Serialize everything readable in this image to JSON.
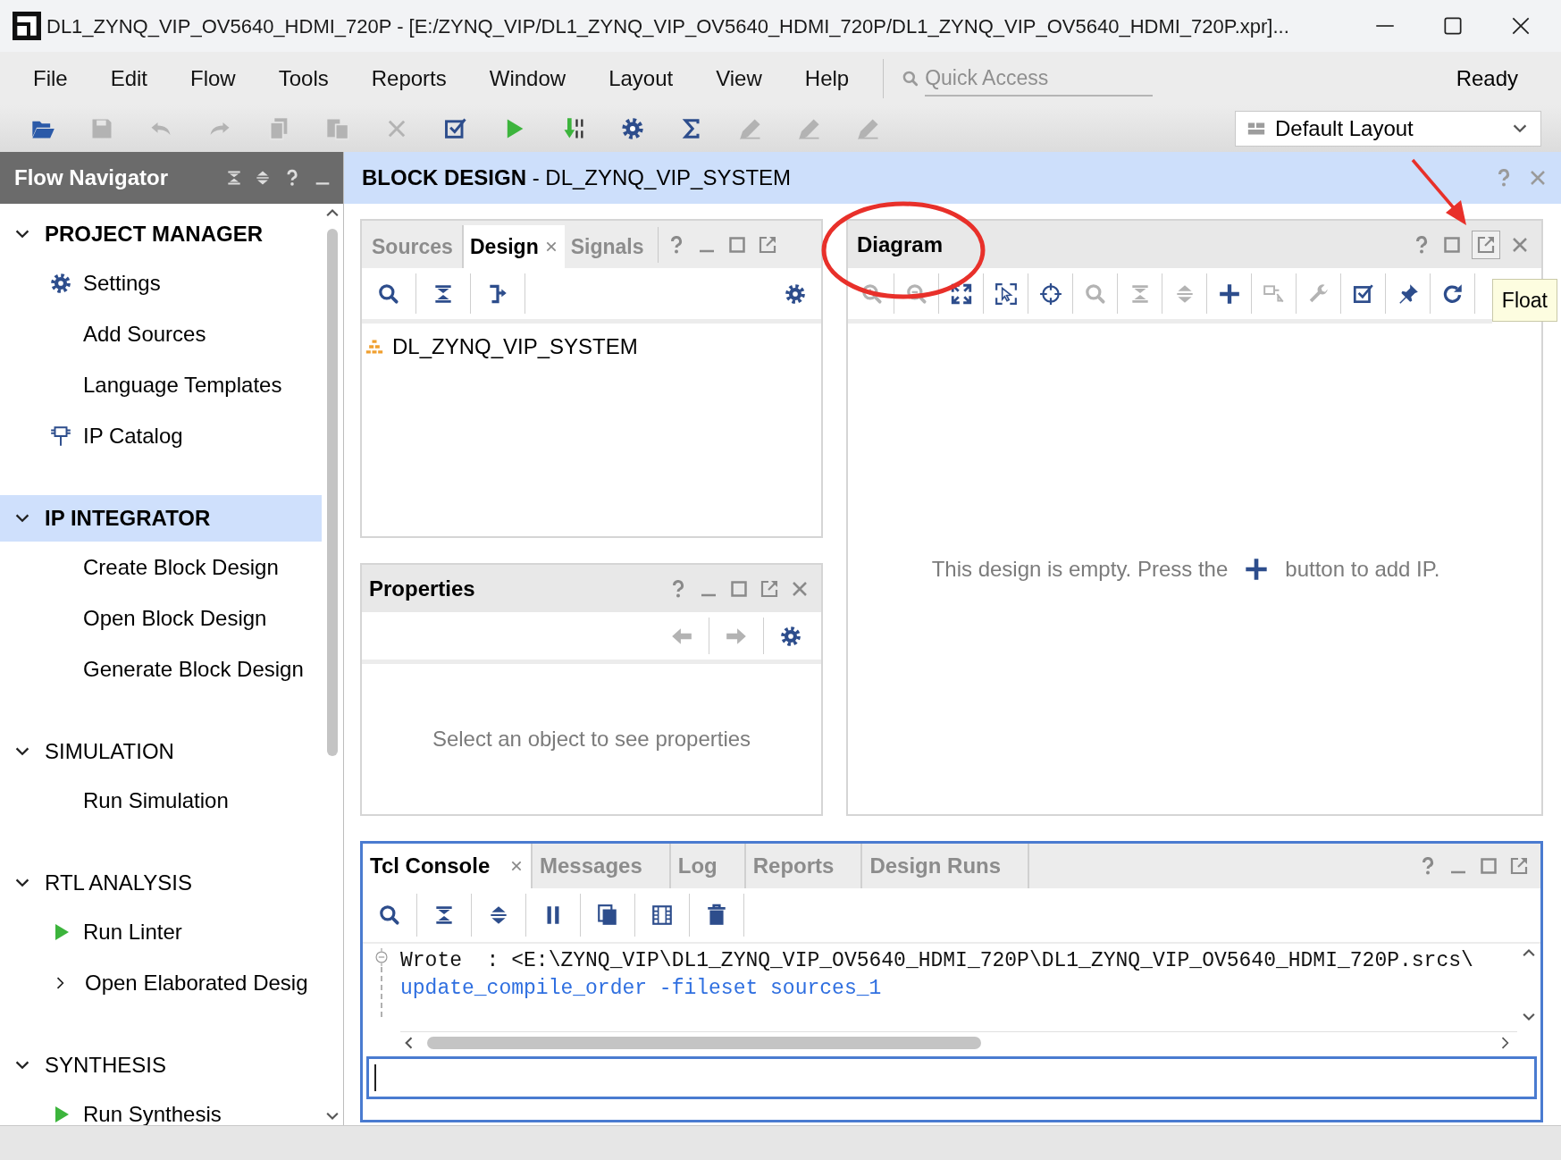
{
  "window": {
    "title": "DL1_ZYNQ_VIP_OV5640_HDMI_720P - [E:/ZYNQ_VIP/DL1_ZYNQ_VIP_OV5640_HDMI_720P/DL1_ZYNQ_VIP_OV5640_HDMI_720P.xpr]..."
  },
  "menu": [
    "File",
    "Edit",
    "Flow",
    "Tools",
    "Reports",
    "Window",
    "Layout",
    "View",
    "Help"
  ],
  "quick_access": {
    "placeholder": "Quick Access"
  },
  "status": "Ready",
  "toolbar": [
    {
      "disabled": false
    },
    {
      "disabled": true
    },
    {
      "disabled": true
    },
    {
      "disabled": true
    },
    {
      "disabled": true
    },
    {
      "disabled": true
    },
    {
      "disabled": true
    },
    {
      "disabled": false
    },
    {
      "disabled": false
    },
    {
      "disabled": false
    },
    {
      "disabled": false
    },
    {
      "disabled": false
    },
    {
      "disabled": true
    },
    {
      "disabled": true
    },
    {
      "disabled": true
    }
  ],
  "layout_selector": {
    "value": "Default Layout"
  },
  "flow_navigator": {
    "title": "Flow Navigator",
    "sections": [
      {
        "label": "PROJECT MANAGER",
        "expanded": true,
        "selected": false,
        "emphasized": true,
        "items": [
          {
            "label": "Settings",
            "kind": "gear"
          },
          {
            "label": "Add Sources",
            "kind": "plain"
          },
          {
            "label": "Language Templates",
            "kind": "plain"
          },
          {
            "label": "IP Catalog",
            "kind": "ip"
          }
        ]
      },
      {
        "label": "IP INTEGRATOR",
        "expanded": true,
        "selected": true,
        "emphasized": true,
        "items": [
          {
            "label": "Create Block Design",
            "kind": "plain"
          },
          {
            "label": "Open Block Design",
            "kind": "plain"
          },
          {
            "label": "Generate Block Design",
            "kind": "plain"
          }
        ]
      },
      {
        "label": "SIMULATION",
        "expanded": true,
        "selected": false,
        "emphasized": false,
        "items": [
          {
            "label": "Run Simulation",
            "kind": "plain"
          }
        ]
      },
      {
        "label": "RTL ANALYSIS",
        "expanded": true,
        "selected": false,
        "emphasized": false,
        "items": [
          {
            "label": "Run Linter",
            "kind": "run"
          },
          {
            "label": "Open Elaborated Desig",
            "kind": "expandable"
          }
        ]
      },
      {
        "label": "SYNTHESIS",
        "expanded": true,
        "selected": false,
        "emphasized": false,
        "items": [
          {
            "label": "Run Synthesis",
            "kind": "run"
          }
        ]
      }
    ]
  },
  "block_design": {
    "title": "BLOCK DESIGN",
    "subtitle": "- DL_ZYNQ_VIP_SYSTEM"
  },
  "design_panel": {
    "tabs": [
      {
        "label": "Sources",
        "selected": false
      },
      {
        "label": "Design",
        "selected": true
      },
      {
        "label": "Signals",
        "selected": false
      }
    ],
    "tree": [
      {
        "label": "DL_ZYNQ_VIP_SYSTEM"
      }
    ]
  },
  "properties_panel": {
    "title": "Properties",
    "toolbar": [
      {
        "disabled": true
      },
      {
        "disabled": true
      },
      {
        "disabled": false
      }
    ],
    "message": "Select an object to see properties"
  },
  "diagram_panel": {
    "title": "Diagram",
    "float_hovered": true,
    "toolbar": [
      {
        "disabled": true
      },
      {
        "disabled": true
      },
      {
        "disabled": false
      },
      {
        "disabled": false
      },
      {
        "disabled": false
      },
      {
        "disabled": true
      },
      {
        "disabled": true
      },
      {
        "disabled": true
      },
      {
        "disabled": false
      },
      {
        "disabled": true
      },
      {
        "disabled": true
      },
      {
        "disabled": false
      },
      {
        "disabled": false
      },
      {
        "disabled": false
      }
    ],
    "message_before": "This design is empty. Press the",
    "message_after": "button to add IP.",
    "tooltip": "Float"
  },
  "tcl_panel": {
    "focused": true,
    "tabs": [
      {
        "label": "Tcl Console",
        "selected": true
      },
      {
        "label": "Messages",
        "selected": false
      },
      {
        "label": "Log",
        "selected": false
      },
      {
        "label": "Reports",
        "selected": false
      },
      {
        "label": "Design Runs",
        "selected": false
      }
    ],
    "lines": [
      {
        "kind": "output",
        "text": "Wrote  : <E:\\ZYNQ_VIP\\DL1_ZYNQ_VIP_OV5640_HDMI_720P\\DL1_ZYNQ_VIP_OV5640_HDMI_720P.srcs\\"
      },
      {
        "kind": "command",
        "text": "update_compile_order -fileset sources_1"
      }
    ],
    "input": {
      "focused": true
    }
  }
}
